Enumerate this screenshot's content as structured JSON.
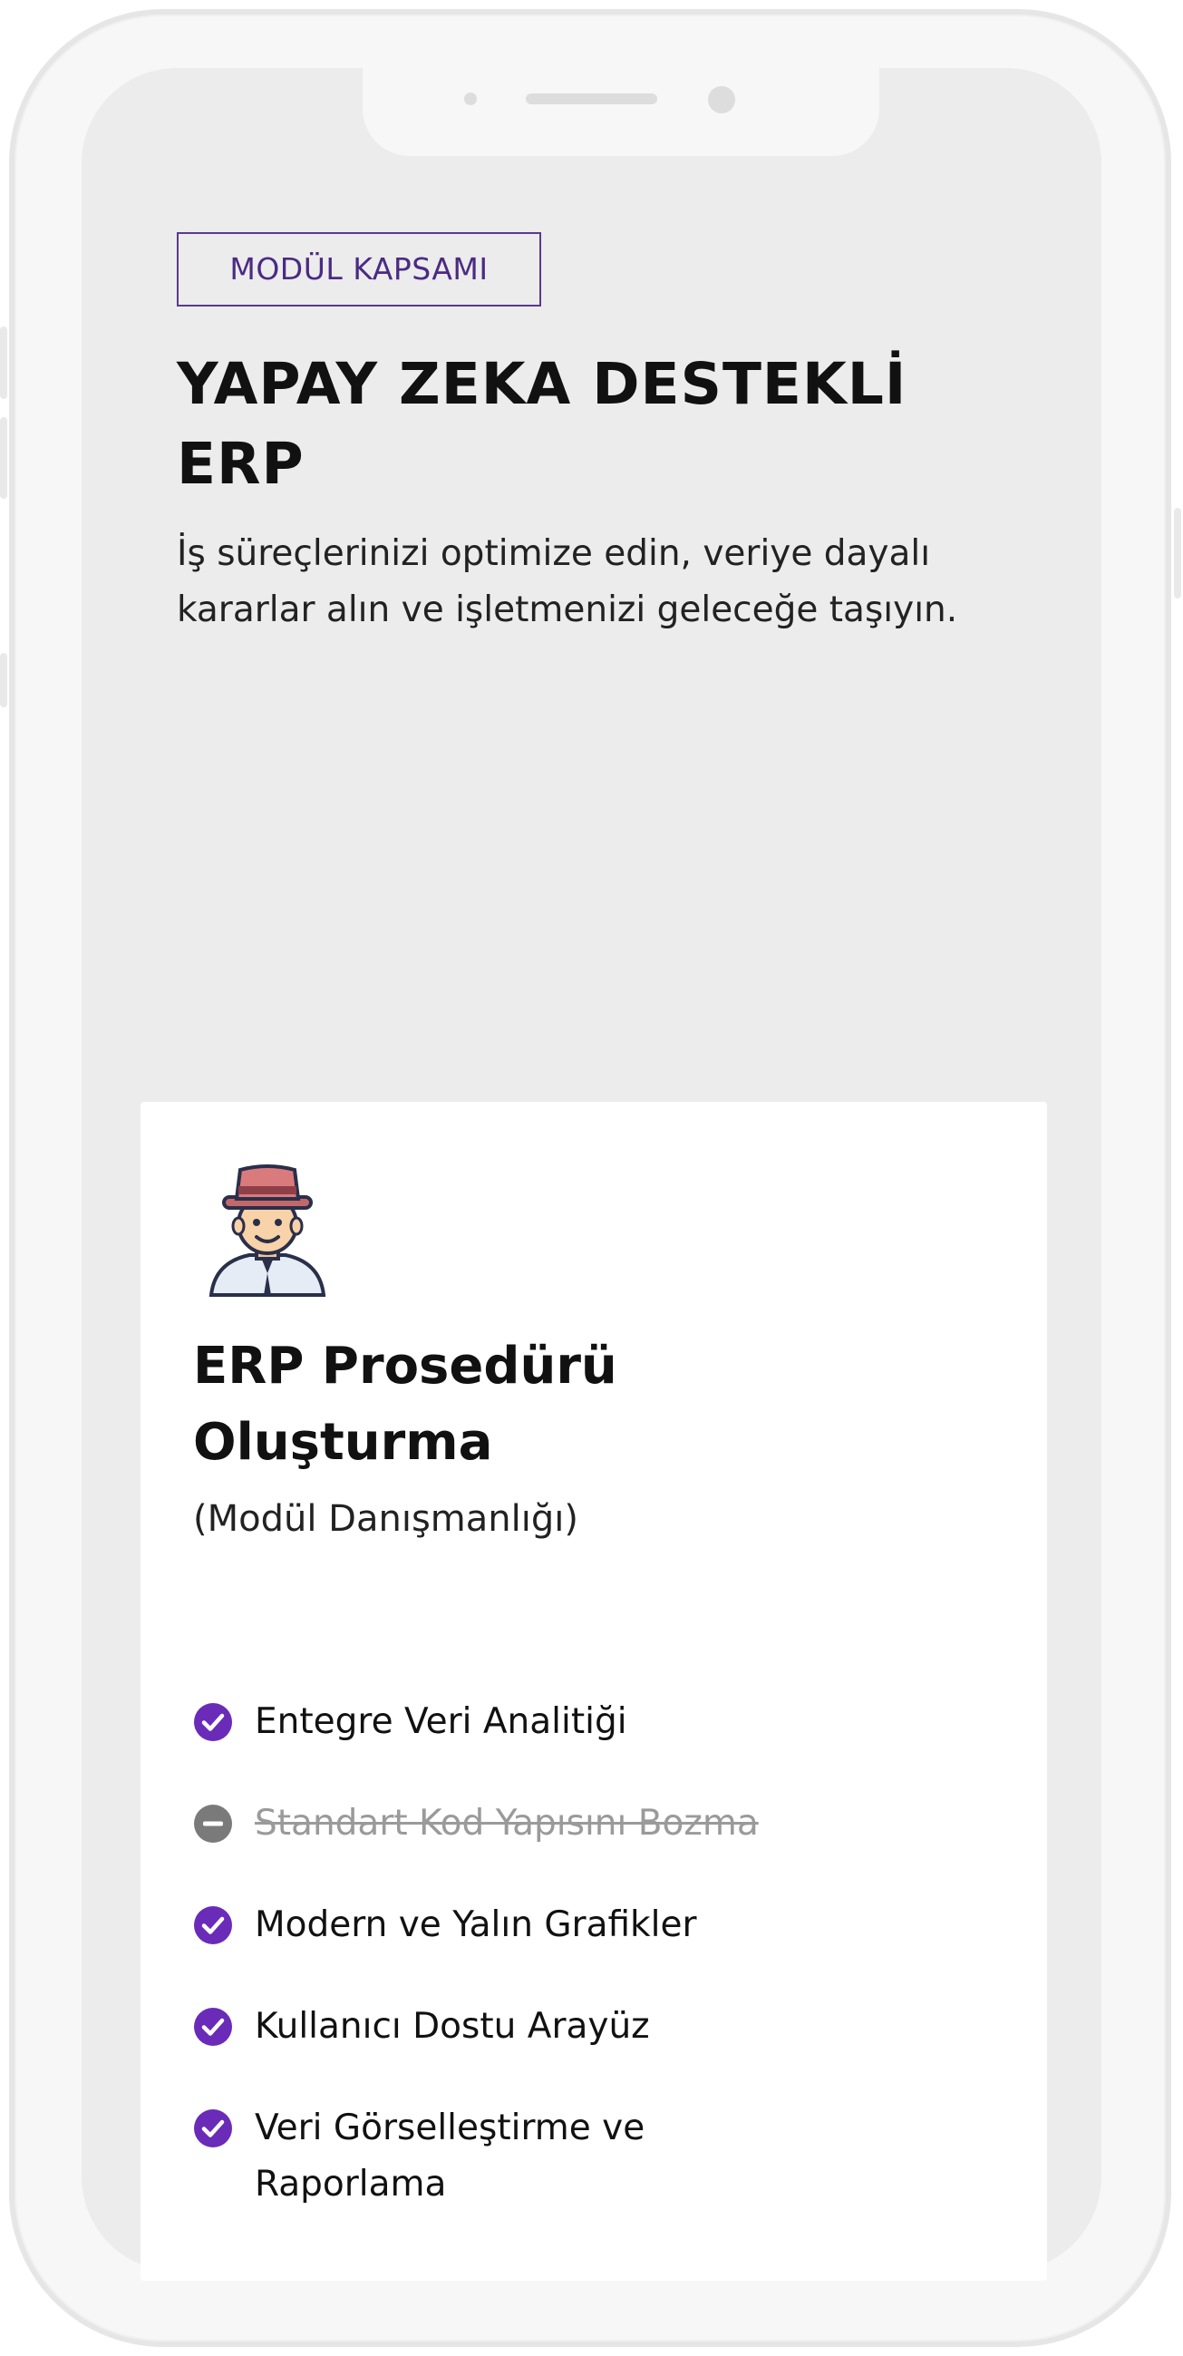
{
  "hero": {
    "badge": "MODÜL KAPSAMI",
    "title_line1": "YAPAY ZEKA DESTEKLİ",
    "title_line2": "ERP",
    "description": "İş süreçlerinizi optimize edin, veriye dayalı kararlar alın ve işletmenizi geleceğe taşıyın."
  },
  "card": {
    "avatar_icon": "consultant-avatar-icon",
    "title_line1": "ERP Prosedürü",
    "title_line2": "Oluşturma",
    "subtitle": "(Modül Danışmanlığı)",
    "features": [
      {
        "label": "Entegre Veri Analitiği",
        "status": "included",
        "icon": "check-circle-icon"
      },
      {
        "label": "Standart Kod Yapısını Bozma",
        "status": "excluded",
        "icon": "minus-circle-icon"
      },
      {
        "label": "Modern ve Yalın Grafikler",
        "status": "included",
        "icon": "check-circle-icon"
      },
      {
        "label": "Kullanıcı Dostu Arayüz",
        "status": "included",
        "icon": "check-circle-icon"
      },
      {
        "label": "Veri Görselleştirme ve Raporlama",
        "status": "included",
        "icon": "check-circle-icon"
      }
    ]
  },
  "colors": {
    "accent": "#6a2bb8",
    "badge_border": "#5a3a8e",
    "excluded": "#7a7a7a",
    "screen_bg": "#ececec",
    "card_bg": "#ffffff"
  }
}
